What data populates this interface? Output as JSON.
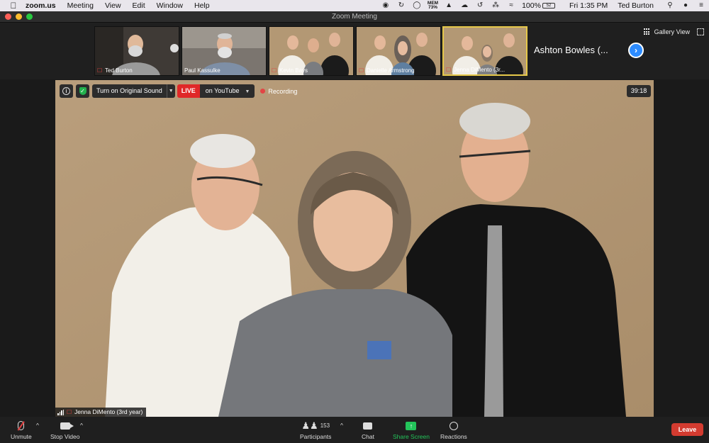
{
  "menubar": {
    "apple_icon": "apple-icon",
    "app_name": "zoom.us",
    "menus": [
      "Meeting",
      "View",
      "Edit",
      "Window",
      "Help"
    ],
    "mem_label": "MEM",
    "mem_value": "73%",
    "battery_percent": "100%",
    "battery_badge": "52",
    "clock": "Fri 1:35 PM",
    "user": "Ted Burton"
  },
  "window": {
    "title": "Zoom Meeting"
  },
  "strip": {
    "participants": [
      {
        "name": "Ted Burton",
        "muted": true,
        "active": false
      },
      {
        "name": "Paul Kassulke",
        "muted": false,
        "active": false
      },
      {
        "name": "Kevin Bays",
        "muted": true,
        "active": false
      },
      {
        "name": "Danielle Armstrong",
        "muted": true,
        "active": false
      },
      {
        "name": "Jenna DiMento (3r...",
        "muted": true,
        "active": true
      }
    ],
    "next_name": "Ashton Bowles (...",
    "gallery_view_label": "Gallery View"
  },
  "video": {
    "sound_label": "Turn on Original Sound",
    "live_label": "LIVE",
    "youtube_label": "on YouTube",
    "recording_label": "Recording",
    "timer": "39:18",
    "speaker_name": "Jenna DiMento (3rd year)"
  },
  "controls": {
    "unmute_label": "Unmute",
    "stop_video_label": "Stop Video",
    "participants_label": "Participants",
    "participants_count": "153",
    "chat_label": "Chat",
    "share_label": "Share Screen",
    "reactions_label": "Reactions",
    "leave_label": "Leave"
  },
  "colors": {
    "accent_blue": "#2d8cff",
    "share_green": "#23c45a",
    "live_red": "#e02828",
    "leave_red": "#d33b30",
    "active_border": "#e6c84a"
  }
}
